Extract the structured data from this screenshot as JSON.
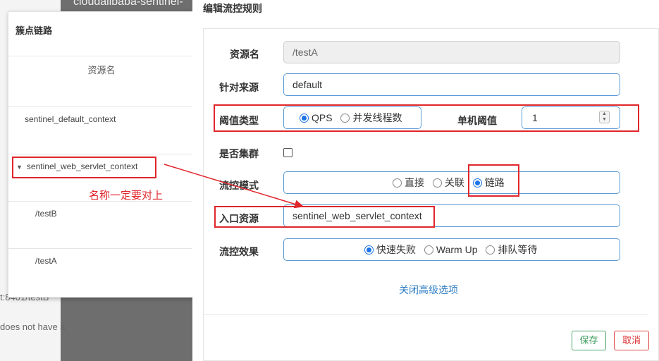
{
  "background": {
    "top_text": "cloudalibaba-sentinel-",
    "side_text_1": "t:8401/testB",
    "side_text_2": "does not have a"
  },
  "tree": {
    "title": "簇点链路",
    "column_header": "资源名",
    "rows": [
      {
        "label": "sentinel_default_context"
      },
      {
        "label": "sentinel_web_servlet_context",
        "expanded": true
      },
      {
        "label": "/testB"
      },
      {
        "label": "/testA"
      }
    ],
    "arrow_icon": "caret-down-icon"
  },
  "dialog": {
    "title": "编辑流控规则",
    "resource_label": "资源名",
    "resource_value": "/testA",
    "origin_label": "针对来源",
    "origin_value": "default",
    "threshold_type_label": "阈值类型",
    "threshold_type_options": [
      "QPS",
      "并发线程数"
    ],
    "threshold_type_selected": "QPS",
    "single_threshold_label": "单机阈值",
    "single_threshold_value": "1",
    "cluster_label": "是否集群",
    "cluster_checked": false,
    "flow_mode_label": "流控模式",
    "flow_mode_options": [
      "直接",
      "关联",
      "链路"
    ],
    "flow_mode_selected": "链路",
    "entry_resource_label": "入口资源",
    "entry_resource_value": "sentinel_web_servlet_context",
    "effect_label": "流控效果",
    "effect_options": [
      "快速失败",
      "Warm Up",
      "排队等待"
    ],
    "effect_selected": "快速失败",
    "advanced_link": "关闭高级选项",
    "save_label": "保存",
    "cancel_label": "取消"
  },
  "annotation": {
    "note": "名称一定要对上",
    "color": "#e0262b"
  },
  "colors": {
    "accent": "#1a73e8",
    "field_border": "#5b9bd5",
    "save": "#3c9c5c",
    "cancel": "#d33333",
    "link": "#2f7ec4"
  }
}
